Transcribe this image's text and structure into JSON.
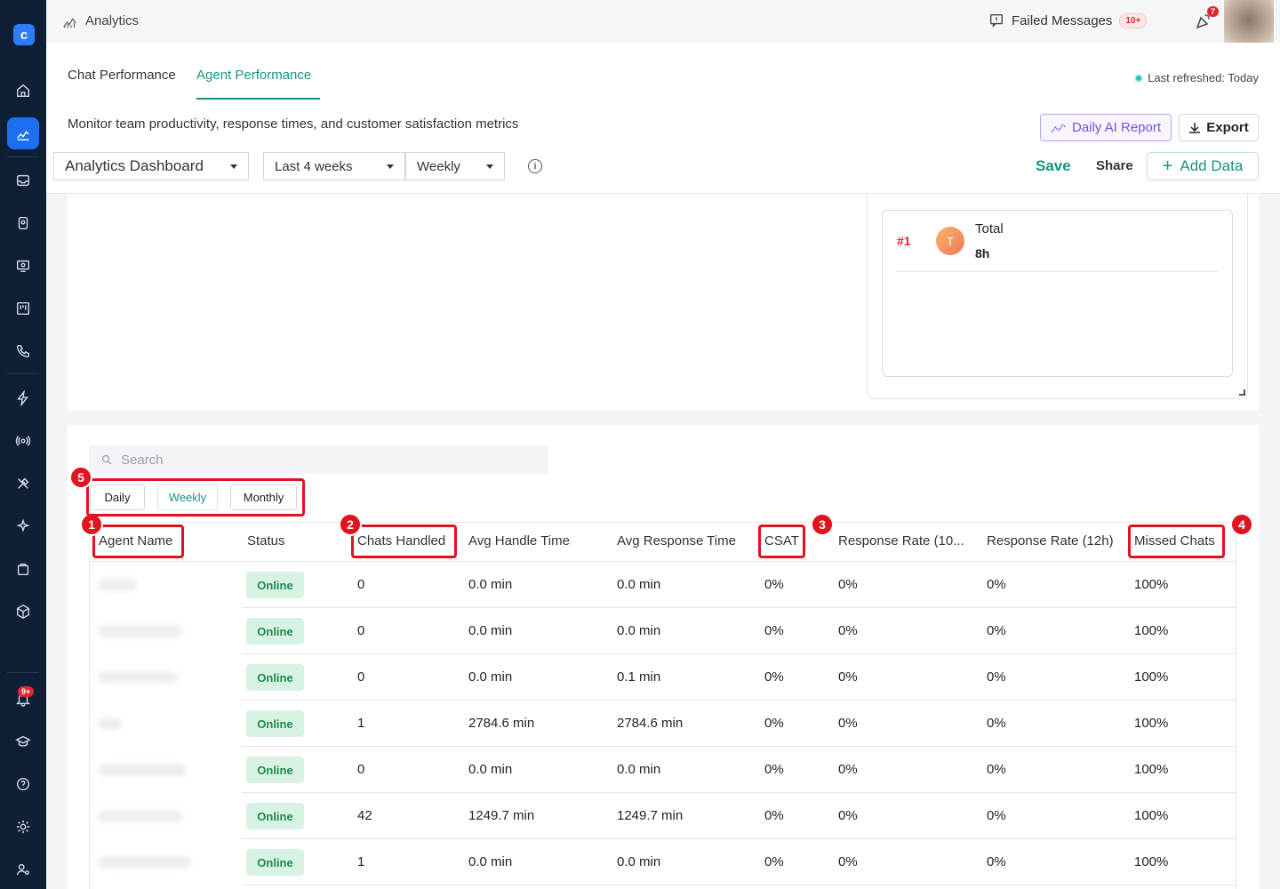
{
  "topbar": {
    "title": "Analytics",
    "failed_messages_label": "Failed Messages",
    "failed_messages_badge": "10+",
    "notification_badge": "7"
  },
  "sidebar": {
    "items": [
      "home-icon",
      "analytics-icon",
      "inbox-icon",
      "contacts-icon",
      "monitor-icon",
      "board-icon",
      "phone-icon",
      "bolt-icon",
      "broadcast-icon",
      "tools-icon",
      "sparkle-icon",
      "bag-icon",
      "package-icon",
      "bell-icon",
      "graduation-icon",
      "help-icon",
      "settings-icon",
      "user-settings-icon"
    ],
    "bell_badge": "9+"
  },
  "tabs": [
    {
      "label": "Chat Performance",
      "active": false
    },
    {
      "label": "Agent Performance",
      "active": true
    }
  ],
  "last_refreshed": "Last refreshed: Today",
  "subtitle": "Monitor team productivity, response times, and customer satisfaction metrics",
  "buttons": {
    "daily_ai_report": "Daily AI Report",
    "export": "Export",
    "save": "Save",
    "share": "Share",
    "add_data": "Add Data"
  },
  "filters": {
    "dashboard": "Analytics Dashboard",
    "range": "Last 4 weeks",
    "granularity": "Weekly"
  },
  "leaderboard": {
    "rank": "#1",
    "avatar_letter": "T",
    "title": "Total",
    "value": "8h"
  },
  "table": {
    "search_placeholder": "Search",
    "periods": [
      {
        "label": "Daily",
        "active": false
      },
      {
        "label": "Weekly",
        "active": true
      },
      {
        "label": "Monthly",
        "active": false
      }
    ],
    "columns": [
      "Agent Name",
      "Status",
      "Chats Handled",
      "Avg Handle Time",
      "Avg Response Time",
      "CSAT",
      "Response Rate (10...",
      "Response Rate (12h)",
      "Missed Chats"
    ],
    "rows": [
      {
        "status": "Online",
        "chats": "0",
        "handle": "0.0 min",
        "response": "0.0 min",
        "csat": "0%",
        "rr10": "0%",
        "rr12": "0%",
        "missed": "100%"
      },
      {
        "status": "Online",
        "chats": "0",
        "handle": "0.0 min",
        "response": "0.0 min",
        "csat": "0%",
        "rr10": "0%",
        "rr12": "0%",
        "missed": "100%"
      },
      {
        "status": "Online",
        "chats": "0",
        "handle": "0.0 min",
        "response": "0.1 min",
        "csat": "0%",
        "rr10": "0%",
        "rr12": "0%",
        "missed": "100%"
      },
      {
        "status": "Online",
        "chats": "1",
        "handle": "2784.6 min",
        "response": "2784.6 min",
        "csat": "0%",
        "rr10": "0%",
        "rr12": "0%",
        "missed": "100%"
      },
      {
        "status": "Online",
        "chats": "0",
        "handle": "0.0 min",
        "response": "0.0 min",
        "csat": "0%",
        "rr10": "0%",
        "rr12": "0%",
        "missed": "100%"
      },
      {
        "status": "Online",
        "chats": "42",
        "handle": "1249.7 min",
        "response": "1249.7 min",
        "csat": "0%",
        "rr10": "0%",
        "rr12": "0%",
        "missed": "100%"
      },
      {
        "status": "Online",
        "chats": "1",
        "handle": "0.0 min",
        "response": "0.0 min",
        "csat": "0%",
        "rr10": "0%",
        "rr12": "0%",
        "missed": "100%"
      }
    ]
  },
  "annotations": [
    "1",
    "2",
    "3",
    "4",
    "5"
  ]
}
